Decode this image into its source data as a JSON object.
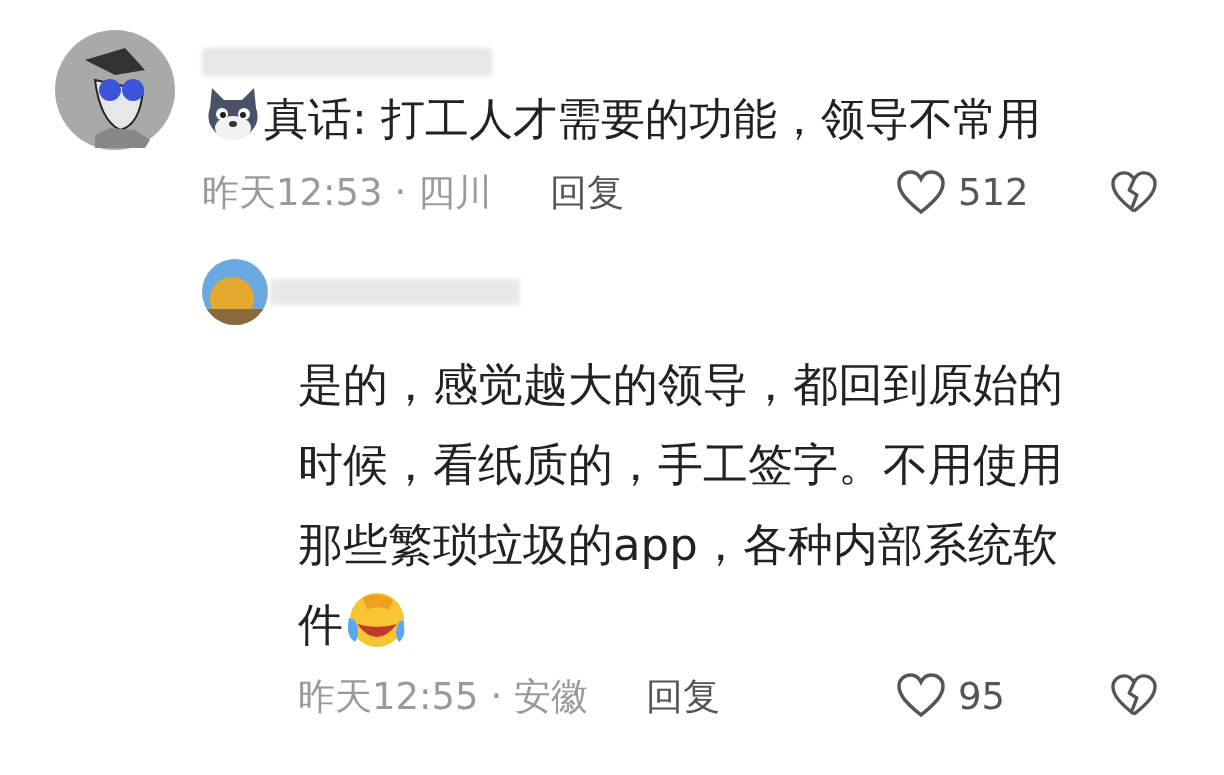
{
  "comments": [
    {
      "content": [
        {
          "kind": "dog"
        },
        {
          "kind": "text",
          "text": "真话: 打工人才需要的功能，领导不常用"
        }
      ],
      "time_location": "昨天12:53 · 四川",
      "reply_label": "回复",
      "likes": "512",
      "replies": [
        {
          "content": [
            {
              "kind": "text",
              "text": "是的，感觉越大的领导，都回到原始的时候，看纸质的，手工签字。不用使用那些繁琐垃圾的app，各种内部系统软件"
            },
            {
              "kind": "laughing"
            }
          ],
          "time_location": "昨天12:55 · 安徽",
          "reply_label": "回复",
          "likes": "95"
        }
      ]
    }
  ]
}
